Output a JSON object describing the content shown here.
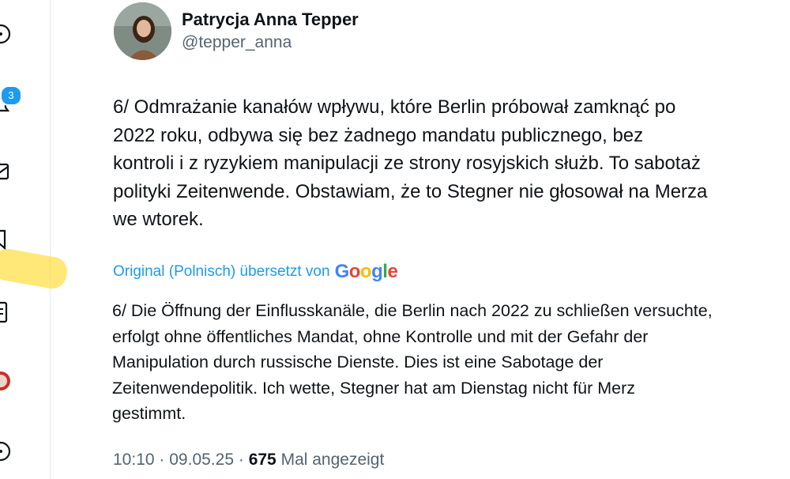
{
  "nav": {
    "icons": [
      "more-circle-icon",
      "notifications-bell-icon",
      "messages-envelope-icon",
      "bookmarks-icon",
      "lists-icon",
      "profile-avatar-icon",
      "more-options-icon"
    ],
    "notification_count": "3"
  },
  "tweet": {
    "author_name": "Patrycja Anna Tepper",
    "author_handle": "@tepper_anna",
    "text": "6/ Odmrażanie kanałów wpływu, które Berlin próbował zamknąć po\n2022 roku, odbywa się bez żadnego mandatu publicznego, bez\nkontroli i z ryzykiem manipulacji ze strony rosyjskich służb. To sabotaż\npolityki Zeitenwende. Obstawiam, że to Stegner nie głosował na Merza\nwe wtorek.",
    "translation_label": "Original (Polnisch) übersetzt von",
    "translation_provider": "Google",
    "translated_text": "6/ Die Öffnung der Einflusskanäle, die Berlin nach 2022 zu schließen versuchte,\nerfolgt ohne öffentliches Mandat, ohne Kontrolle und mit der Gefahr der\nManipulation durch russische Dienste. Dies ist eine Sabotage der\nZeitenwendepolitik. Ich wette, Stegner hat am Dienstag nicht für Merz\ngestimmt.",
    "time": "10:10",
    "separator": "·",
    "date": "09.05.25",
    "views": "675",
    "views_label": "Mal angezeigt"
  },
  "colors": {
    "accent": "#1d9bf0",
    "text_primary": "#0f1419",
    "text_secondary": "#536471",
    "highlight": "#ffd60a"
  }
}
